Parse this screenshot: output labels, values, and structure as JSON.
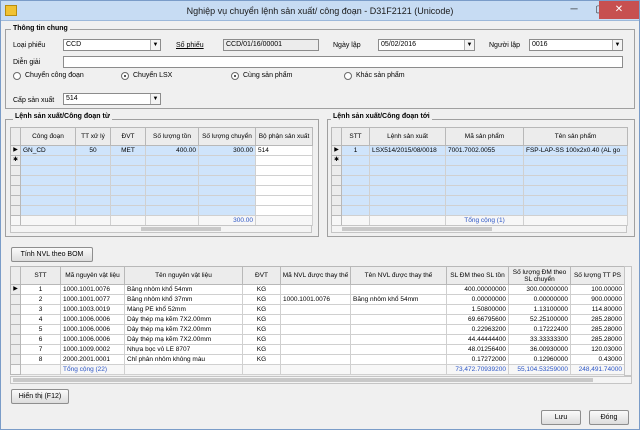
{
  "window": {
    "title": "Nghiệp vụ chuyển lệnh sản xuất/ công đoạn - D31F2121 (Unicode)"
  },
  "general": {
    "group_title": "Thông tin chung",
    "loai_phieu_label": "Loại phiếu",
    "loai_phieu_value": "CCD",
    "so_phieu_label": "Số phiếu",
    "so_phieu_value": "CCD/01/16/00001",
    "ngay_lap_label": "Ngày lập",
    "ngay_lap_value": "05/02/2016",
    "nguoi_lap_label": "Người lập",
    "nguoi_lap_value": "0016",
    "dien_giai_label": "Diễn giải",
    "dien_giai_value": "",
    "radio_1": "Chuyển công đoạn",
    "radio_2": "Chuyển LSX",
    "radio_3": "Cùng sản phẩm",
    "radio_4": "Khác sản phẩm",
    "cap_sx_label": "Cấp sản xuất",
    "cap_sx_value": "514"
  },
  "from_grid": {
    "title": "Lệnh sản xuất/Công đoạn từ",
    "headers": [
      "Công đoạn",
      "TT xử lý",
      "ĐVT",
      "Số lượng tồn",
      "Số lượng chuyển",
      "Bộ phận sản xuất"
    ],
    "row": [
      "GN_CD",
      "50",
      "MET",
      "400.00",
      "300.00",
      "514"
    ],
    "total": "300.00"
  },
  "to_grid": {
    "title": "Lệnh sản xuất/Công đoạn tới",
    "headers": [
      "STT",
      "Lệnh sản xuất",
      "Mã sản phẩm",
      "Tên sản phẩm"
    ],
    "row": [
      "1",
      "LSX514/2015/08/0018",
      "7001.7002.0055",
      "FSP-LAP-SS 100x2x0.40 (AL go"
    ],
    "total": "Tổng cộng (1)"
  },
  "bom_button": "Tính NVL theo BOM",
  "material_grid": {
    "headers": [
      "STT",
      "Mã nguyên vật liệu",
      "Tên nguyên vật liệu",
      "ĐVT",
      "Mã NVL được thay thế",
      "Tên NVL được thay thế",
      "SL ĐM theo SL tồn",
      "Số lượng ĐM theo SL chuyển",
      "Số lượng TT PS"
    ],
    "rows": [
      [
        "1",
        "1000.1001.0076",
        "Băng nhôm khổ 54mm",
        "KG",
        "",
        "",
        "400.00000000",
        "300.00000000",
        "100.00000"
      ],
      [
        "2",
        "1000.1001.0077",
        "Băng nhôm khổ 37mm",
        "KG",
        "1000.1001.0076",
        "Băng nhôm khổ 54mm",
        "0.00000000",
        "0.00000000",
        "900.00000"
      ],
      [
        "3",
        "1000.1003.0019",
        "Màng PE  khổ  52mm",
        "KG",
        "",
        "",
        "1.50800000",
        "1.13100000",
        "114.80000"
      ],
      [
        "4",
        "1000.1006.0006",
        "Dây thép mạ kẽm 7X2.00mm",
        "KG",
        "",
        "",
        "69.66795600",
        "52.25100000",
        "285.28000"
      ],
      [
        "5",
        "1000.1006.0006",
        "Dây thép mạ kẽm 7X2.00mm",
        "KG",
        "",
        "",
        "0.22963200",
        "0.17222400",
        "285.28000"
      ],
      [
        "6",
        "1000.1006.0006",
        "Dây thép mạ kẽm 7X2.00mm",
        "KG",
        "",
        "",
        "44.44444400",
        "33.33333300",
        "285.28000"
      ],
      [
        "7",
        "1000.1009.0002",
        "Nhựa bọc vỏ LE 8707",
        "KG",
        "",
        "",
        "48.01256400",
        "36.00930000",
        "120.03000"
      ],
      [
        "8",
        "2000.2001.0001",
        "Chỉ phân nhôm không màu",
        "KG",
        "",
        "",
        "0.17272000",
        "0.12960000",
        "0.43000"
      ]
    ],
    "total_label": "Tổng cộng (22)",
    "total_sl_ton": "73,472.70939200",
    "total_sl_chuyen": "55,104.53259000",
    "total_tt": "248,491.74000"
  },
  "buttons": {
    "hien_thi": "Hiển thị (F12)",
    "luu": "Lưu",
    "dong": "Đóng"
  }
}
